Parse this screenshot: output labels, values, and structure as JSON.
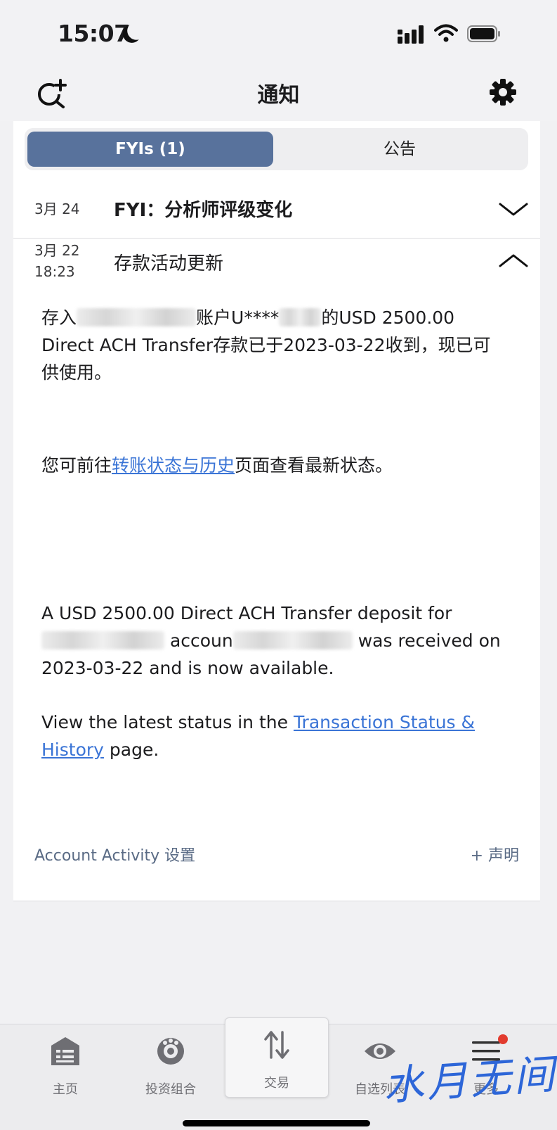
{
  "status_bar": {
    "time": "15:07"
  },
  "nav": {
    "title": "通知"
  },
  "tabs": {
    "fyi": "FYIs (1)",
    "announcements": "公告"
  },
  "items": [
    {
      "date": "3月 24",
      "title": "FYI：分析师评级变化"
    },
    {
      "date": "3月 22",
      "time": "18:23",
      "title": "存款活动更新"
    }
  ],
  "message": {
    "zh_p1_a": "存入",
    "zh_p1_b": "账户U****",
    "zh_p1_c": "的USD 2500.00 Direct ACH Transfer存款已于2023-03-22收到，现已可供使用。",
    "zh_p2_a": "您可前往",
    "zh_p2_link": "转账状态与历史",
    "zh_p2_b": "页面查看最新状态。",
    "en_p1_a": "A USD 2500.00 Direct ACH Transfer deposit for",
    "en_p1_b": "accoun",
    "en_p1_c": "was received on 2023-03-22 and is now available.",
    "en_p2_a": "View the latest status in the ",
    "en_p2_link": "Transaction Status & History",
    "en_p2_b": " page."
  },
  "footer": {
    "settings": "Account Activity 设置",
    "disclaimer": "+ 声明"
  },
  "tabbar": {
    "home": "主页",
    "portfolio": "投资组合",
    "trade": "交易",
    "watchlist": "自选列表",
    "more": "更多"
  },
  "watermark": "水月无间",
  "colors": {
    "accent": "#58729c",
    "link": "#3a74d6",
    "badge": "#e23b2e"
  }
}
